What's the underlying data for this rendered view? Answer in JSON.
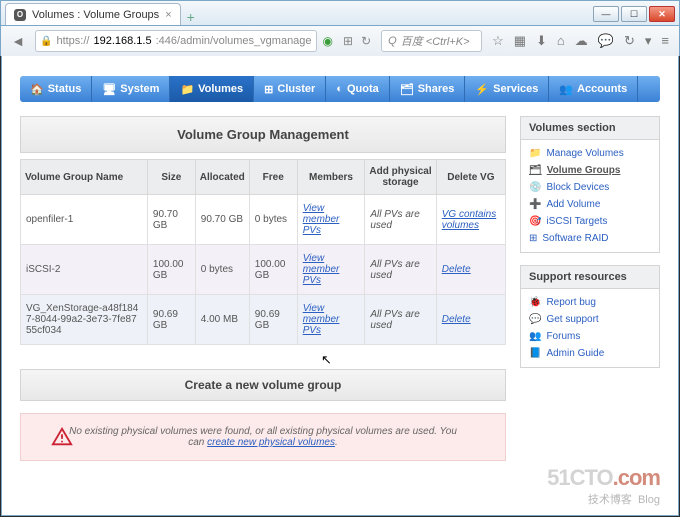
{
  "browser": {
    "tab_title": "Volumes : Volume Groups",
    "url": "https://192.168.1.5:446/admin/volumes_vgmanage",
    "url_host": "192.168.1.5",
    "url_path": ":446/admin/volumes_vgmanage",
    "search_placeholder": "百度 <Ctrl+K>"
  },
  "nav": [
    {
      "icon": "🏠",
      "label": "Status"
    },
    {
      "icon": "🖥",
      "label": "System"
    },
    {
      "icon": "📁",
      "label": "Volumes",
      "active": true
    },
    {
      "icon": "⊞",
      "label": "Cluster"
    },
    {
      "icon": "◐",
      "label": "Quota"
    },
    {
      "icon": "🗂",
      "label": "Shares"
    },
    {
      "icon": "⚡",
      "label": "Services"
    },
    {
      "icon": "👥",
      "label": "Accounts"
    }
  ],
  "page_title": "Volume Group Management",
  "columns": [
    "Volume Group Name",
    "Size",
    "Allocated",
    "Free",
    "Members",
    "Add physical storage",
    "Delete VG"
  ],
  "rows": [
    {
      "name": "openfiler-1",
      "size": "90.70 GB",
      "alloc": "90.70 GB",
      "free": "0 bytes",
      "members": "View member PVs",
      "add": "All PVs are used",
      "del": "VG contains volumes"
    },
    {
      "name": "iSCSI-2",
      "size": "100.00 GB",
      "alloc": "0 bytes",
      "free": "100.00 GB",
      "members": "View member PVs",
      "add": "All PVs are used",
      "del": "Delete"
    },
    {
      "name": "VG_XenStorage-a48f1847-8044-99a2-3e73-7fe8755cf034",
      "size": "90.69 GB",
      "alloc": "4.00 MB",
      "free": "90.69 GB",
      "members": "View member PVs",
      "add": "All PVs are used",
      "del": "Delete"
    }
  ],
  "create_title": "Create a new volume group",
  "warn_text": "No existing physical volumes were found, or all existing physical volumes are used. You can ",
  "warn_link": "create new physical volumes",
  "side": {
    "volumes": {
      "title": "Volumes section",
      "items": [
        {
          "icon": "📁",
          "label": "Manage Volumes"
        },
        {
          "icon": "🗂",
          "label": "Volume Groups",
          "active": true
        },
        {
          "icon": "💿",
          "label": "Block Devices"
        },
        {
          "icon": "➕",
          "label": "Add Volume"
        },
        {
          "icon": "🎯",
          "label": "iSCSI Targets"
        },
        {
          "icon": "⊞",
          "label": "Software RAID"
        }
      ]
    },
    "support": {
      "title": "Support resources",
      "items": [
        {
          "icon": "🐞",
          "label": "Report bug"
        },
        {
          "icon": "💬",
          "label": "Get support"
        },
        {
          "icon": "👥",
          "label": "Forums"
        },
        {
          "icon": "📘",
          "label": "Admin Guide"
        }
      ]
    }
  },
  "watermark": {
    "brand": "51CTO.com",
    "sub": "技术博客",
    "tag": "Blog"
  }
}
